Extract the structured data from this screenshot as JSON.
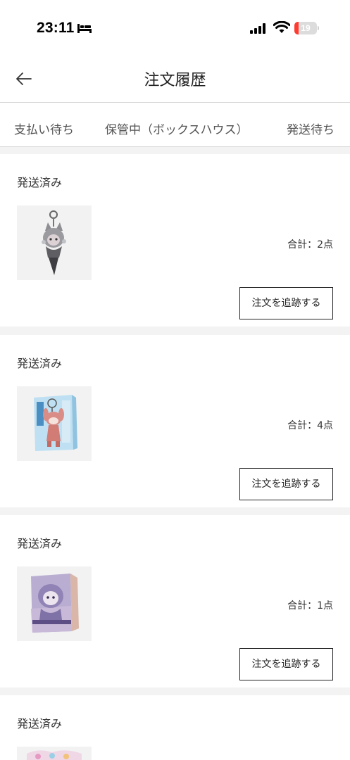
{
  "status_bar": {
    "time": "23:11",
    "battery_level": "19",
    "battery_fraction": 0.19
  },
  "header": {
    "title": "注文履歴"
  },
  "tabs": [
    {
      "label": "支払い待ち"
    },
    {
      "label": "保管中（ボックスハウス）"
    },
    {
      "label": "発送待ち"
    }
  ],
  "orders": [
    {
      "status": "発送済み",
      "total": "合計：2点",
      "track_label": "注文を追跡する"
    },
    {
      "status": "発送済み",
      "total": "合計：4点",
      "track_label": "注文を追跡する"
    },
    {
      "status": "発送済み",
      "total": "合計：1点",
      "track_label": "注文を追跡する"
    },
    {
      "status": "発送済み"
    }
  ],
  "colors": {
    "gap": "#f3f3f3",
    "divider": "#d6d6d6",
    "battery_red": "#ff3b30"
  }
}
